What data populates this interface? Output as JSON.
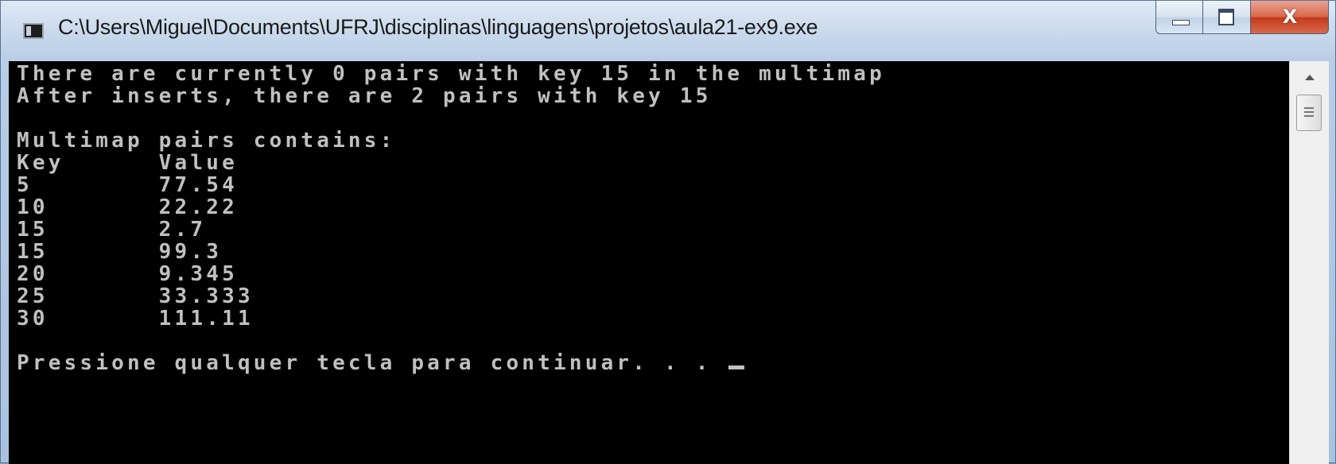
{
  "window": {
    "title": "C:\\Users\\Miguel\\Documents\\UFRJ\\disciplinas\\linguagens\\projetos\\aula21-ex9.exe",
    "icon": "console-app-icon"
  },
  "caption_buttons": {
    "minimize": "minimize-icon",
    "maximize": "maximize-icon",
    "close": "close-icon",
    "close_glyph": "X"
  },
  "console": {
    "lines": [
      "There are currently 0 pairs with key 15 in the multimap",
      "After inserts, there are 2 pairs with key 15",
      "",
      "Multimap pairs contains:",
      "Key      Value",
      "5        77.54",
      "10       22.22",
      "15       2.7",
      "15       99.3",
      "20       9.345",
      "25       33.333",
      "30       111.11",
      "",
      "Pressione qualquer tecla para continuar. . . "
    ],
    "text_color": "#c0c0c0",
    "background": "#000000"
  },
  "scrollbar": {
    "up_arrow": "arrow-up-icon",
    "thumb": "scroll-thumb"
  }
}
